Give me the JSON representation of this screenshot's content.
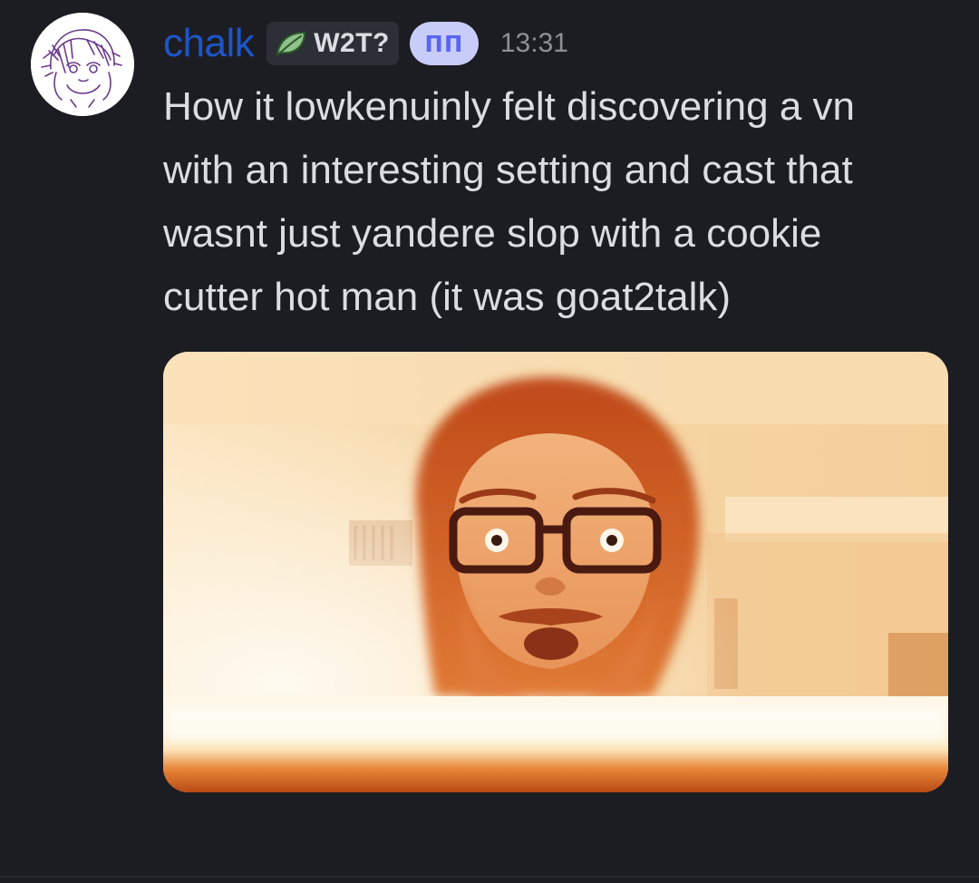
{
  "theme": {
    "background": "#1c1d22",
    "username_color": "#1e55c8",
    "text_color": "#dcdde2",
    "timestamp_color": "#8e9097",
    "clan_tag_bg": "#2d2f36",
    "role_badge_bg": "#c8ccf8",
    "role_badge_text": "#5865f2"
  },
  "message": {
    "author": {
      "username": "chalk",
      "avatar_icon": "anime-sketch-avatar-icon",
      "clan_tag": {
        "icon": "leaf-icon",
        "label": "W2T?"
      },
      "role_badge": "пп"
    },
    "timestamp": "13:31",
    "content_lines": [
      "How it lowkenuinly felt discovering a vn",
      "with an interesting setting and cast that",
      "wasnt just yandere slop with a cookie",
      "cutter hot man (it was goat2talk)"
    ],
    "attachment": {
      "type": "gif"
    }
  }
}
